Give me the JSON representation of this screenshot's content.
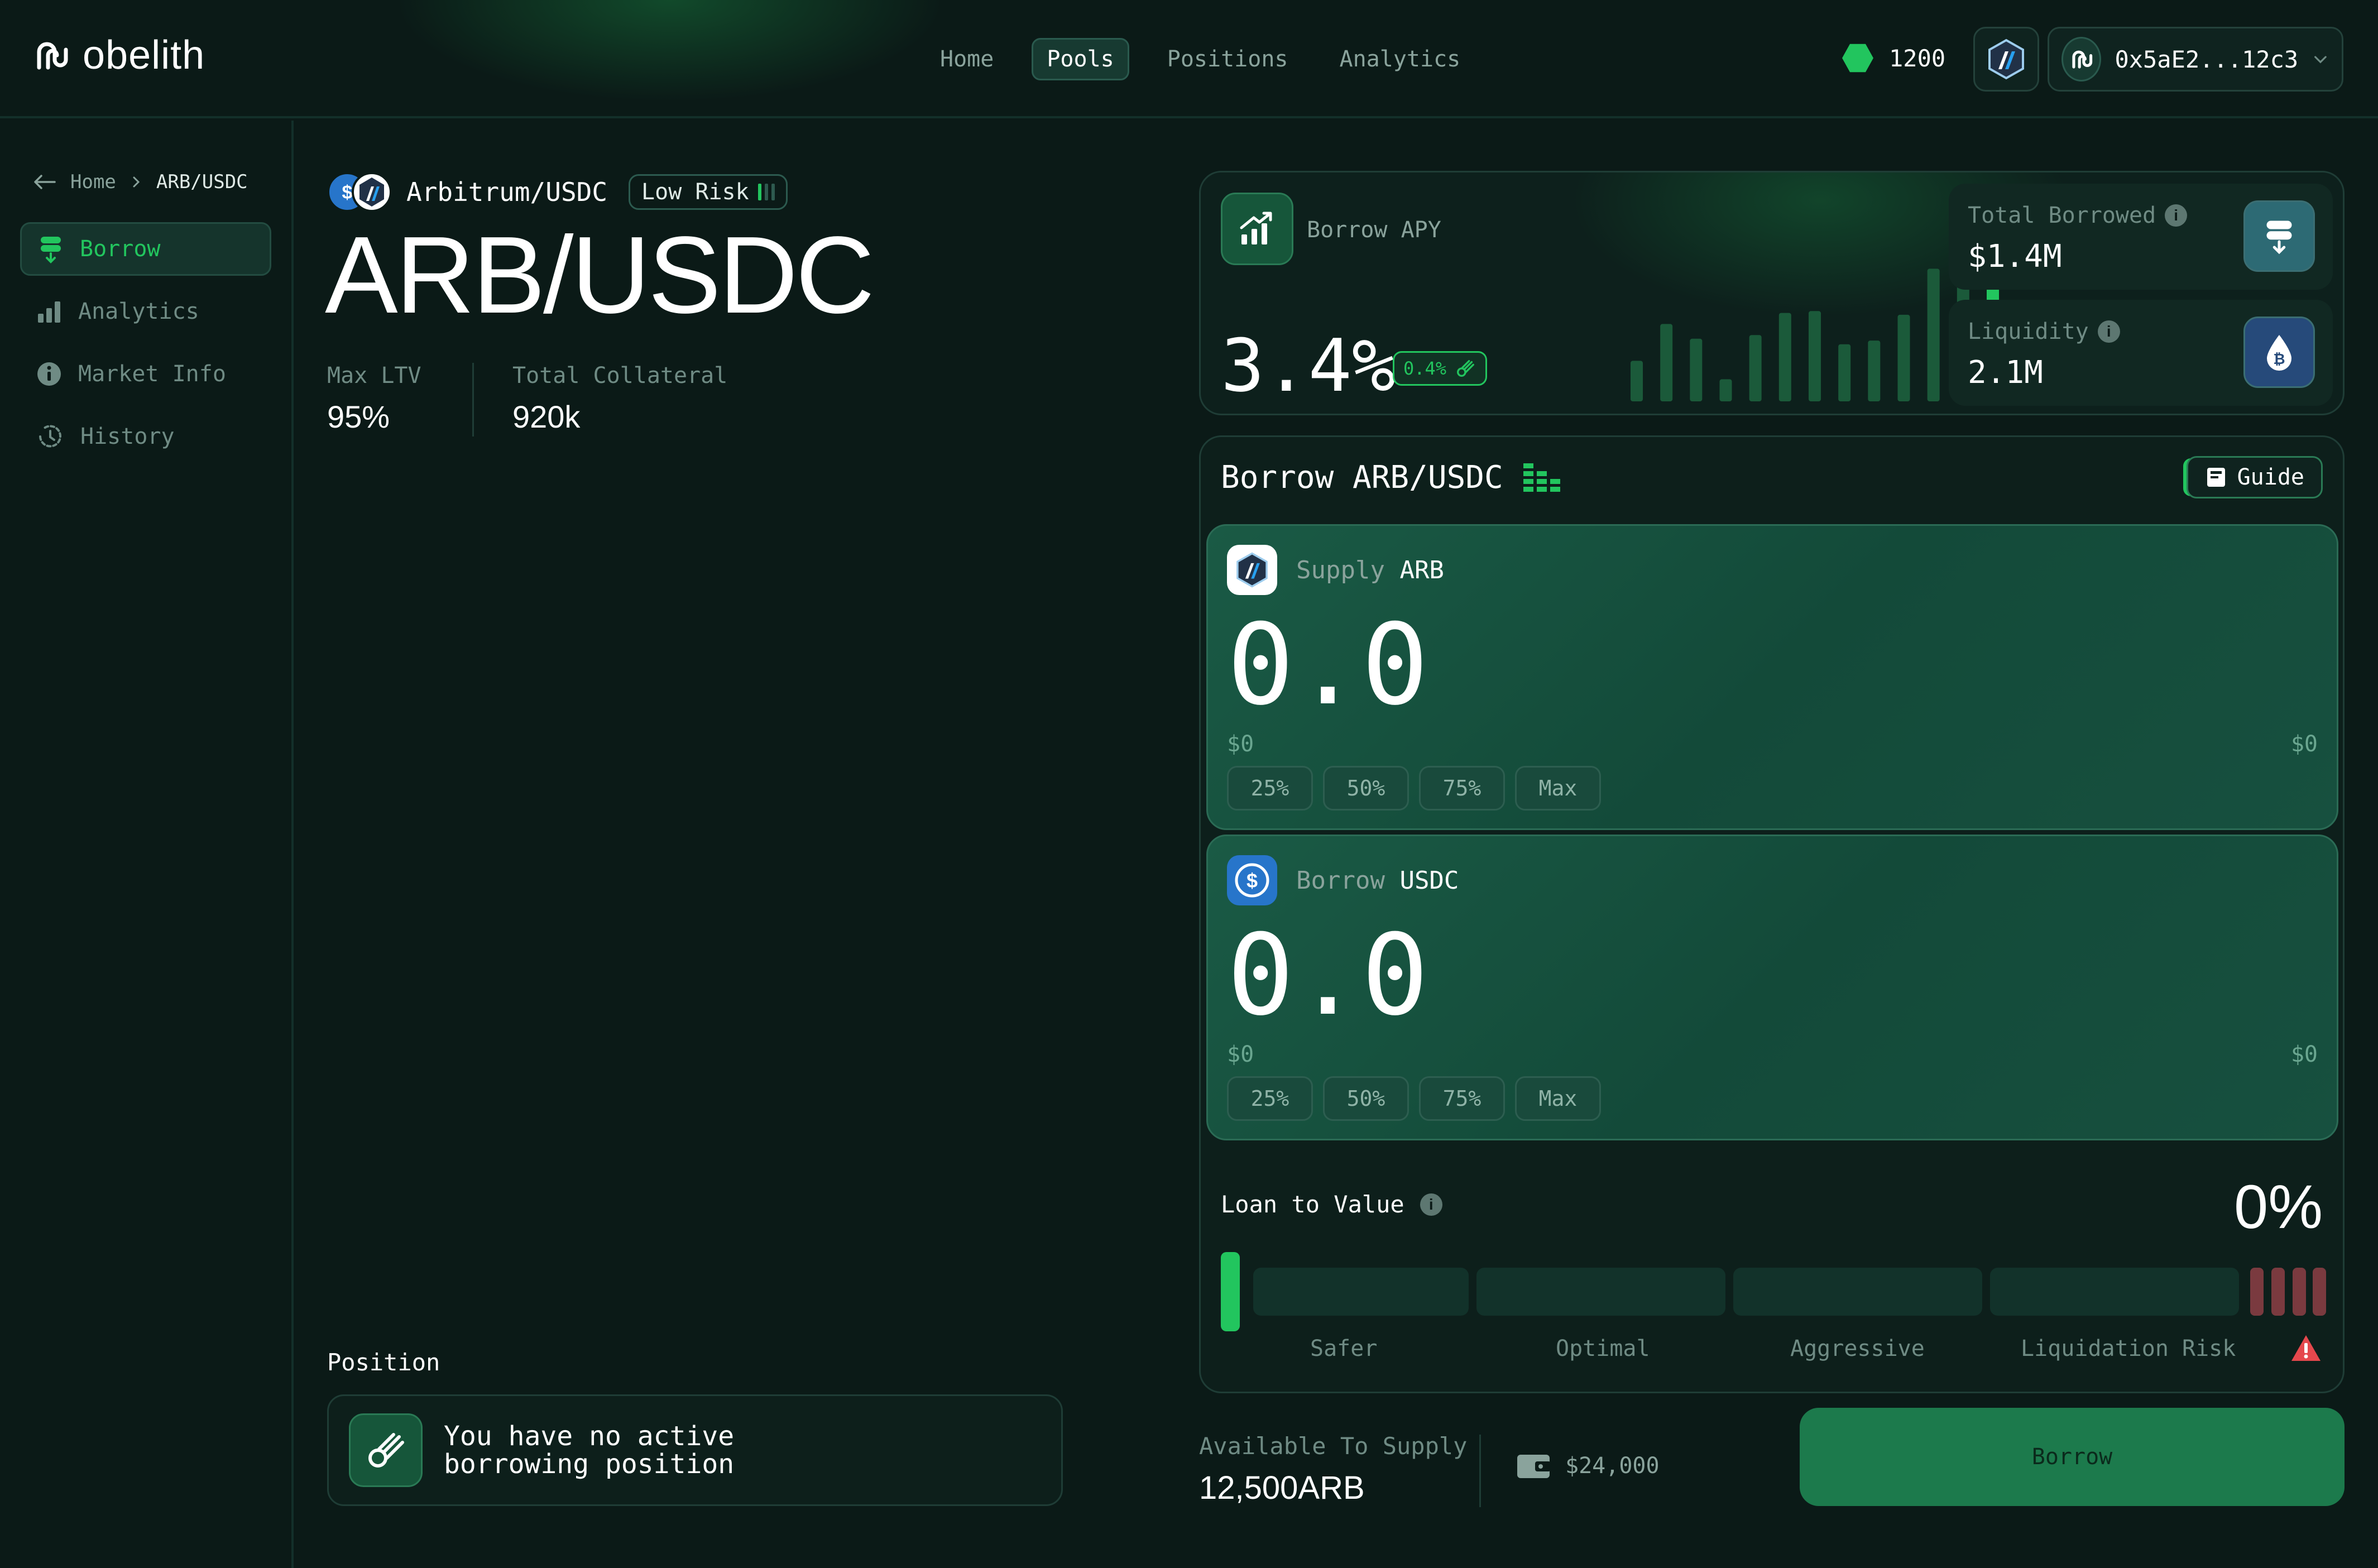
{
  "app": {
    "name": "obelith"
  },
  "nav": {
    "items": [
      {
        "label": "Home",
        "active": false
      },
      {
        "label": "Pools",
        "active": true
      },
      {
        "label": "Positions",
        "active": false
      },
      {
        "label": "Analytics",
        "active": false
      }
    ]
  },
  "header": {
    "points": "1200",
    "wallet_address": "0x5aE2...12c3",
    "chain_icon": "arbitrum-icon"
  },
  "breadcrumb": {
    "home": "Home",
    "current": "ARB/USDC"
  },
  "sidebar": {
    "items": [
      {
        "label": "Borrow",
        "icon": "borrow-stack-icon",
        "active": true
      },
      {
        "label": "Analytics",
        "icon": "bar-chart-icon",
        "active": false
      },
      {
        "label": "Market Info",
        "icon": "info-icon",
        "active": false
      },
      {
        "label": "History",
        "icon": "history-icon",
        "active": false
      }
    ]
  },
  "pool": {
    "pair_name": "Arbitrum/USDC",
    "risk": "Low Risk",
    "title": "ARB/USDC",
    "max_ltv_label": "Max LTV",
    "max_ltv": "95%",
    "total_collateral_label": "Total Collateral",
    "total_collateral": "920k"
  },
  "position": {
    "label": "Position",
    "empty_text": "You have no active borrowing position"
  },
  "apy": {
    "label": "Borrow APY",
    "value": "3.4%",
    "change": "0.4%",
    "bars": [
      0.22,
      0.42,
      0.34,
      0.12,
      0.36,
      0.48,
      0.49,
      0.31,
      0.33,
      0.47,
      0.72,
      0.81,
      1.0
    ]
  },
  "stats": {
    "total_borrowed_label": "Total Borrowed",
    "total_borrowed": "$1.4M",
    "liquidity_label": "Liquidity",
    "liquidity": "2.1M"
  },
  "borrow_form": {
    "title": "Borrow ARB/USDC",
    "guide_label": "Guide",
    "supply": {
      "verb": "Supply",
      "token": "ARB",
      "amount": "0.0",
      "usd_left": "$0",
      "usd_right": "$0"
    },
    "borrow": {
      "verb": "Borrow",
      "token": "USDC",
      "amount": "0.0",
      "usd_left": "$0",
      "usd_right": "$0"
    },
    "pct_buttons": [
      "25%",
      "50%",
      "75%",
      "Max"
    ]
  },
  "ltv": {
    "label": "Loan to Value",
    "value": "0%",
    "zones": [
      "Safer",
      "Optimal",
      "Aggressive",
      "Liquidation Risk"
    ]
  },
  "footer": {
    "available_label": "Available To Supply",
    "available_value": "12,500ARB",
    "wallet_balance": "$24,000",
    "borrow_button": "Borrow"
  },
  "colors": {
    "accent": "#22c55e",
    "background": "#0b1a17",
    "danger": "#e5484d",
    "danger_bar": "#7a3a3f"
  }
}
